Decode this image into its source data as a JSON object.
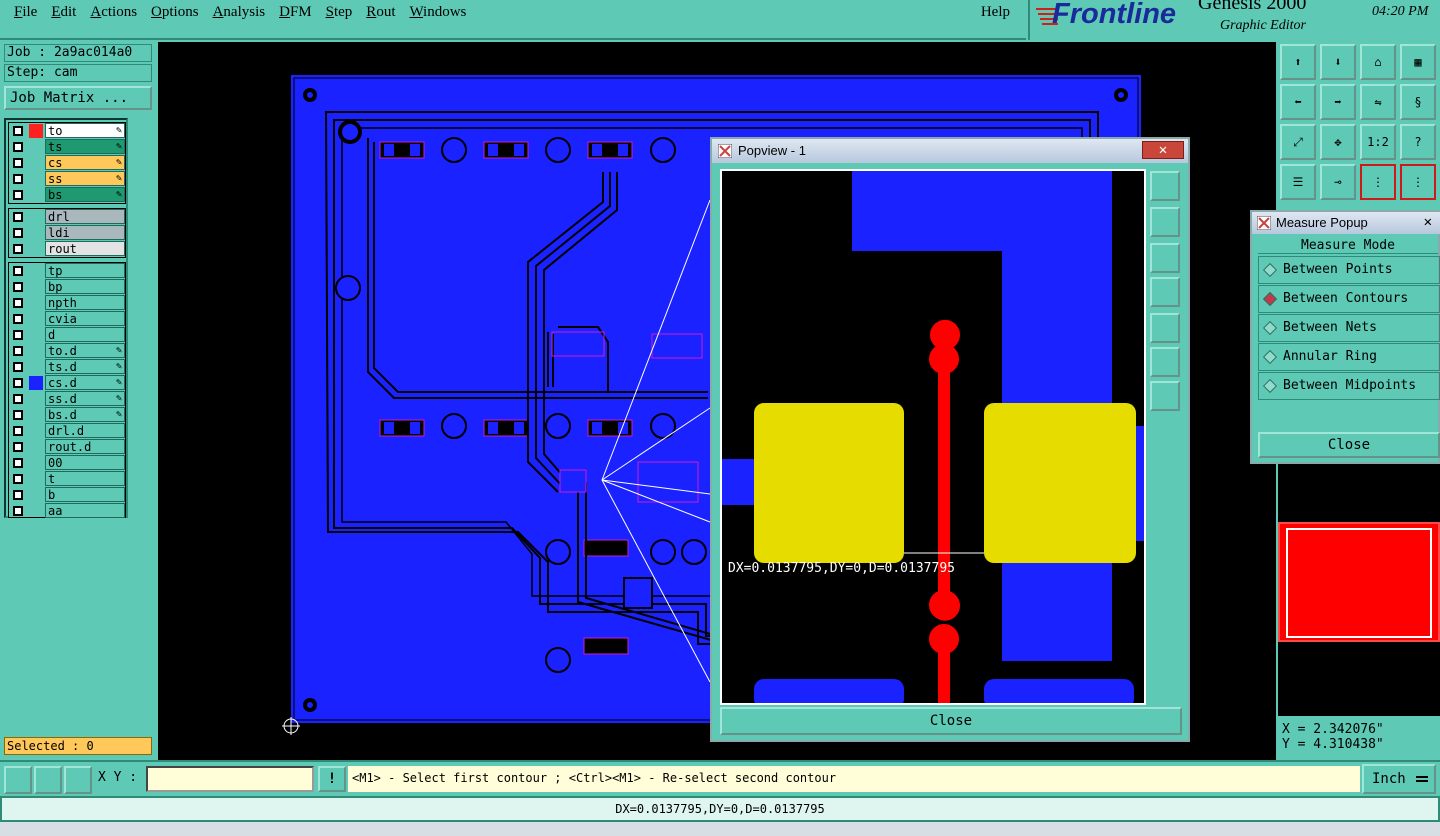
{
  "menu": {
    "items": [
      "File",
      "Edit",
      "Actions",
      "Options",
      "Analysis",
      "DFM",
      "Step",
      "Rout",
      "Windows"
    ],
    "help": "Help"
  },
  "brand": {
    "logo": "Frontline",
    "product": "Genesis 2000",
    "subtitle": "Graphic Editor",
    "time": "04:20 PM"
  },
  "job": {
    "job_line": "Job : 2a9ac014a0",
    "step_line": "Step: cam",
    "matrix_button": "Job Matrix ..."
  },
  "layers": {
    "group1": [
      {
        "name": "to",
        "color": "#ffffff",
        "flag": "✎"
      },
      {
        "name": "ts",
        "color": "#1f9a70",
        "flag": "✎"
      },
      {
        "name": "cs",
        "color": "#ffc85a",
        "flag": "✎"
      },
      {
        "name": "ss",
        "color": "#ffc85a",
        "flag": "✎"
      },
      {
        "name": "bs",
        "color": "#1f9a70",
        "flag": "✎"
      }
    ],
    "group2": [
      {
        "name": "drl",
        "color": "#a9b8bd"
      },
      {
        "name": "ldi",
        "color": "#a9b8bd"
      },
      {
        "name": "rout",
        "color": "#e3e3e3"
      }
    ],
    "group3": [
      {
        "name": "tp"
      },
      {
        "name": "bp"
      },
      {
        "name": "npth"
      },
      {
        "name": "cvia"
      },
      {
        "name": "d"
      },
      {
        "name": "to.d",
        "flag": "✎"
      },
      {
        "name": "ts.d",
        "flag": "✎"
      },
      {
        "name": "cs.d",
        "flag": "✎",
        "active": true
      },
      {
        "name": "ss.d",
        "flag": "✎"
      },
      {
        "name": "bs.d",
        "flag": "✎"
      },
      {
        "name": "drl.d"
      },
      {
        "name": "rout.d"
      },
      {
        "name": "00"
      },
      {
        "name": "t"
      },
      {
        "name": "b"
      },
      {
        "name": "aa"
      }
    ],
    "selected": "Selected : 0"
  },
  "popview": {
    "title": "Popview - 1",
    "measure_text": "DX=0.0137795,DY=0,D=0.0137795",
    "close_label": "Close"
  },
  "measure": {
    "title": "Measure Popup",
    "mode_label": "Measure Mode",
    "options": [
      "Between Points",
      "Between Contours",
      "Between Nets",
      "Annular Ring",
      "Between Midpoints"
    ],
    "selected_option": "Between Contours",
    "close_label": "Close"
  },
  "coords": {
    "x": "X = 2.342076\"",
    "y": "Y = 4.310438\""
  },
  "bottom": {
    "xy_label": "X Y :",
    "xy_value": "",
    "prompt": "<M1> - Select first contour ; <Ctrl><M1> - Re-select second contour",
    "units": "Inch",
    "status": "DX=0.0137795,DY=0,D=0.0137795"
  },
  "toolbox": {
    "scale_label": "1:2",
    "help_label": "?"
  },
  "colors": {
    "panel": "#5ec9b4",
    "copper": "#1a22ff",
    "pad": "#e6dc00",
    "trace": "#ff0000"
  }
}
